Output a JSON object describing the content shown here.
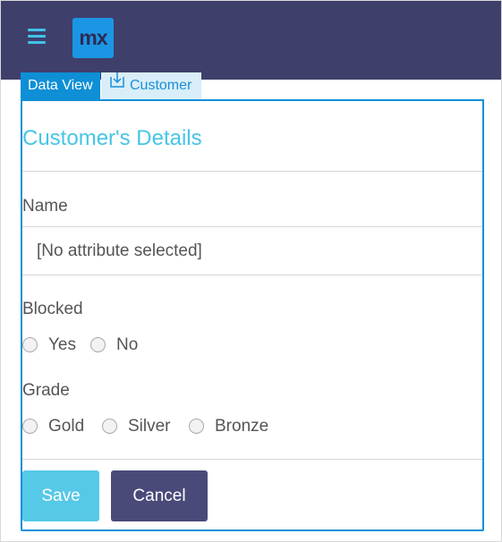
{
  "tabs": {
    "dataview_label": "Data View",
    "customer_label": "Customer"
  },
  "logo": {
    "text": "mx"
  },
  "form": {
    "title": "Customer's Details",
    "name_label": "Name",
    "name_value": "[No attribute selected]",
    "blocked_label": "Blocked",
    "blocked_options": [
      "Yes",
      "No"
    ],
    "grade_label": "Grade",
    "grade_options": [
      "Gold",
      "Silver",
      "Bronze"
    ]
  },
  "buttons": {
    "save_label": "Save",
    "cancel_label": "Cancel"
  },
  "colors": {
    "topbar": "#3f3f6b",
    "accent": "#0e8fd6",
    "title": "#46c5e6",
    "save": "#56c8e8",
    "cancel": "#4a4a7a"
  },
  "icons": {
    "menu": "hamburger-menu-icon",
    "entity": "download-entity-icon"
  }
}
